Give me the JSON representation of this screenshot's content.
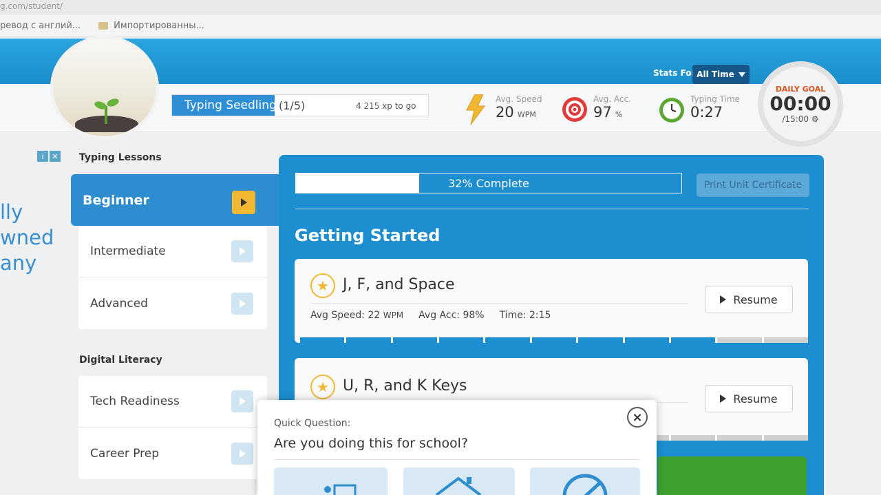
{
  "browser": {
    "url": "g.com/student/",
    "bookmarks": [
      "ревод с англий...",
      "Импортированны..."
    ]
  },
  "header": {
    "stats_for_label": "Stats For:",
    "stats_range": "All Time",
    "level_name": "Typing Seedling",
    "level_count": "(1/5)",
    "level_progress_fraction": 0.4,
    "xp_to_go": "4 215 xp to go",
    "avg_speed_label": "Avg. Speed",
    "avg_speed_value": "20",
    "avg_speed_unit": "WPM",
    "avg_acc_label": "Avg. Acc.",
    "avg_acc_value": "97",
    "avg_acc_unit": "%",
    "typing_time_label": "Typing Time",
    "typing_time_value": "0:27",
    "daily_goal_label": "DAILY GOAL",
    "daily_goal_time": "00:00",
    "daily_goal_target": "/15:00 ⚙"
  },
  "ad": {
    "text_lines": [
      "lly",
      "wned",
      "any"
    ]
  },
  "sidebar": {
    "heading_lessons": "Typing Lessons",
    "active_item": "Beginner",
    "lesson_items": [
      "Intermediate",
      "Advanced"
    ],
    "heading_literacy": "Digital Literacy",
    "literacy_items": [
      "Tech Readiness",
      "Career Prep"
    ]
  },
  "main": {
    "progress_text": "32% Complete",
    "progress_fraction": 0.32,
    "print_button": "Print Unit Certificate",
    "section_title": "Getting Started",
    "lessons": [
      {
        "title": "J, F, and Space",
        "resume": "Resume",
        "avg_speed": "Avg Speed: 22",
        "avg_speed_unit": "WPM",
        "avg_acc": "Avg Acc: 98%",
        "time": "Time: 2:15",
        "segments_total": 11,
        "segments_done": 9
      },
      {
        "title": "U, R, and K Keys",
        "resume": "Resume",
        "segments_total": 11,
        "segments_done": 0
      }
    ]
  },
  "popup": {
    "label": "Quick Question:",
    "question": "Are you doing this for school?",
    "close": "×"
  },
  "colors": {
    "brand_blue": "#1d8ed0",
    "accent_yellow": "#f1b731",
    "goal_orange": "#d9541e"
  }
}
